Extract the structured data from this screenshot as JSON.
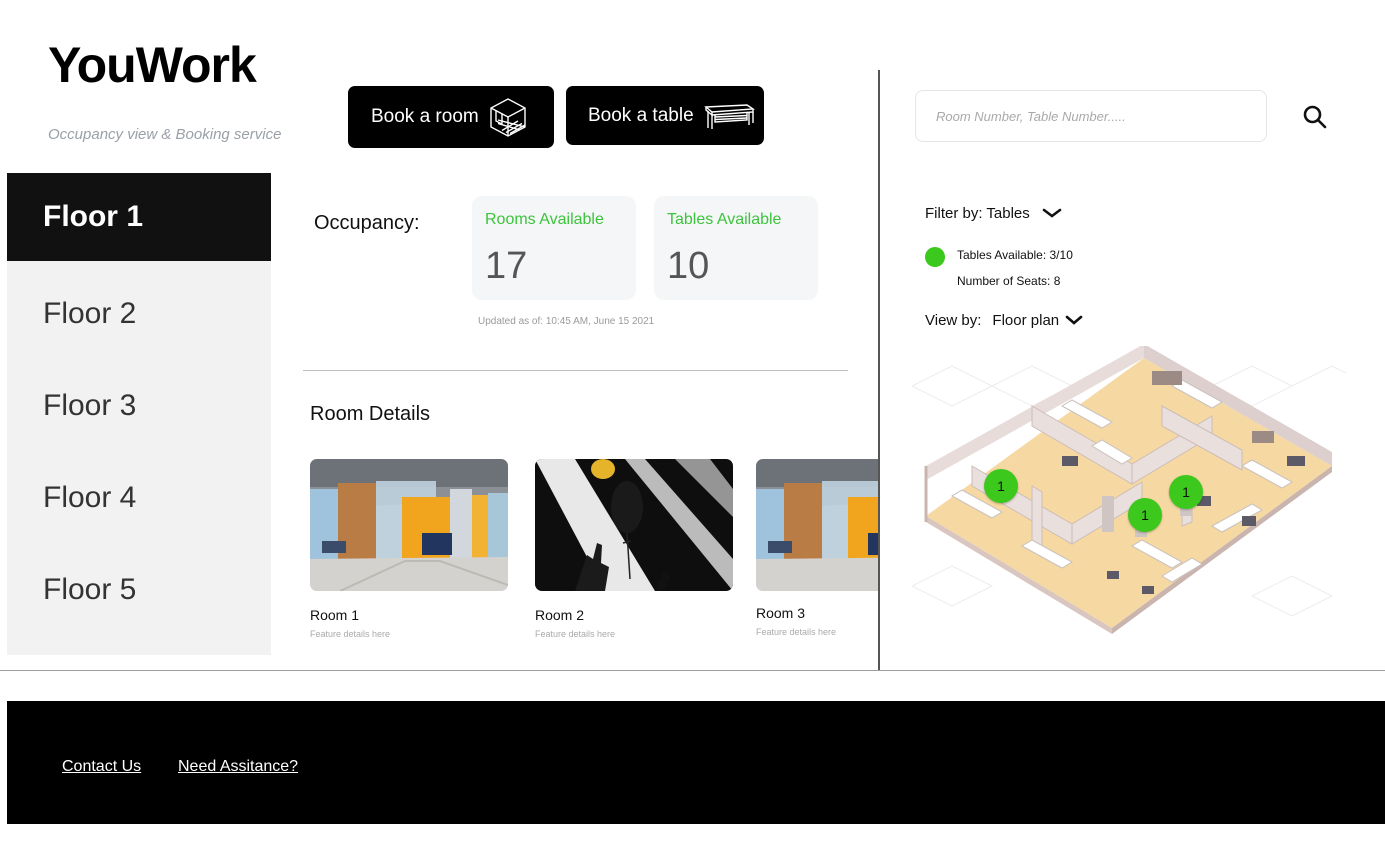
{
  "header": {
    "brand": "YouWork",
    "tagline": "Occupancy view &  Booking service",
    "book_room_label": "Book a room",
    "book_table_label": "Book a table"
  },
  "search": {
    "placeholder": "Room Number, Table Number....."
  },
  "sidebar": {
    "items": [
      {
        "label": "Floor 1",
        "active": true
      },
      {
        "label": "Floor 2",
        "active": false
      },
      {
        "label": "Floor 3",
        "active": false
      },
      {
        "label": "Floor 4",
        "active": false
      },
      {
        "label": "Floor 5",
        "active": false
      }
    ]
  },
  "occupancy": {
    "label": "Occupancy:",
    "cards": [
      {
        "title": "Rooms Available",
        "value": "17"
      },
      {
        "title": "Tables Available",
        "value": "10"
      }
    ],
    "updated": "Updated as of: 10:45 AM, June 15 2021"
  },
  "room_details": {
    "title": "Room Details",
    "rooms": [
      {
        "name": "Room 1",
        "feature": "Feature details here"
      },
      {
        "name": "Room 2",
        "feature": "Feature details here"
      },
      {
        "name": "Room 3",
        "feature": "Feature details here"
      }
    ]
  },
  "right_panel": {
    "filter_label": "Filter by: Tables",
    "legend_tables": "Tables Available: 3/10",
    "legend_seats": "Number of Seats: 8",
    "view_label": "View by:",
    "view_value": "Floor plan",
    "markers": [
      "1",
      "1",
      "1"
    ]
  },
  "footer": {
    "contact": "Contact Us",
    "assistance": "Need Assitance?"
  },
  "colors": {
    "accent_green": "#3cc81c",
    "dark": "#000000",
    "sidebar_bg": "#f2f2f2"
  },
  "icons": [
    "room-cube-icon",
    "table-icon",
    "search-icon",
    "chevron-down-icon"
  ]
}
